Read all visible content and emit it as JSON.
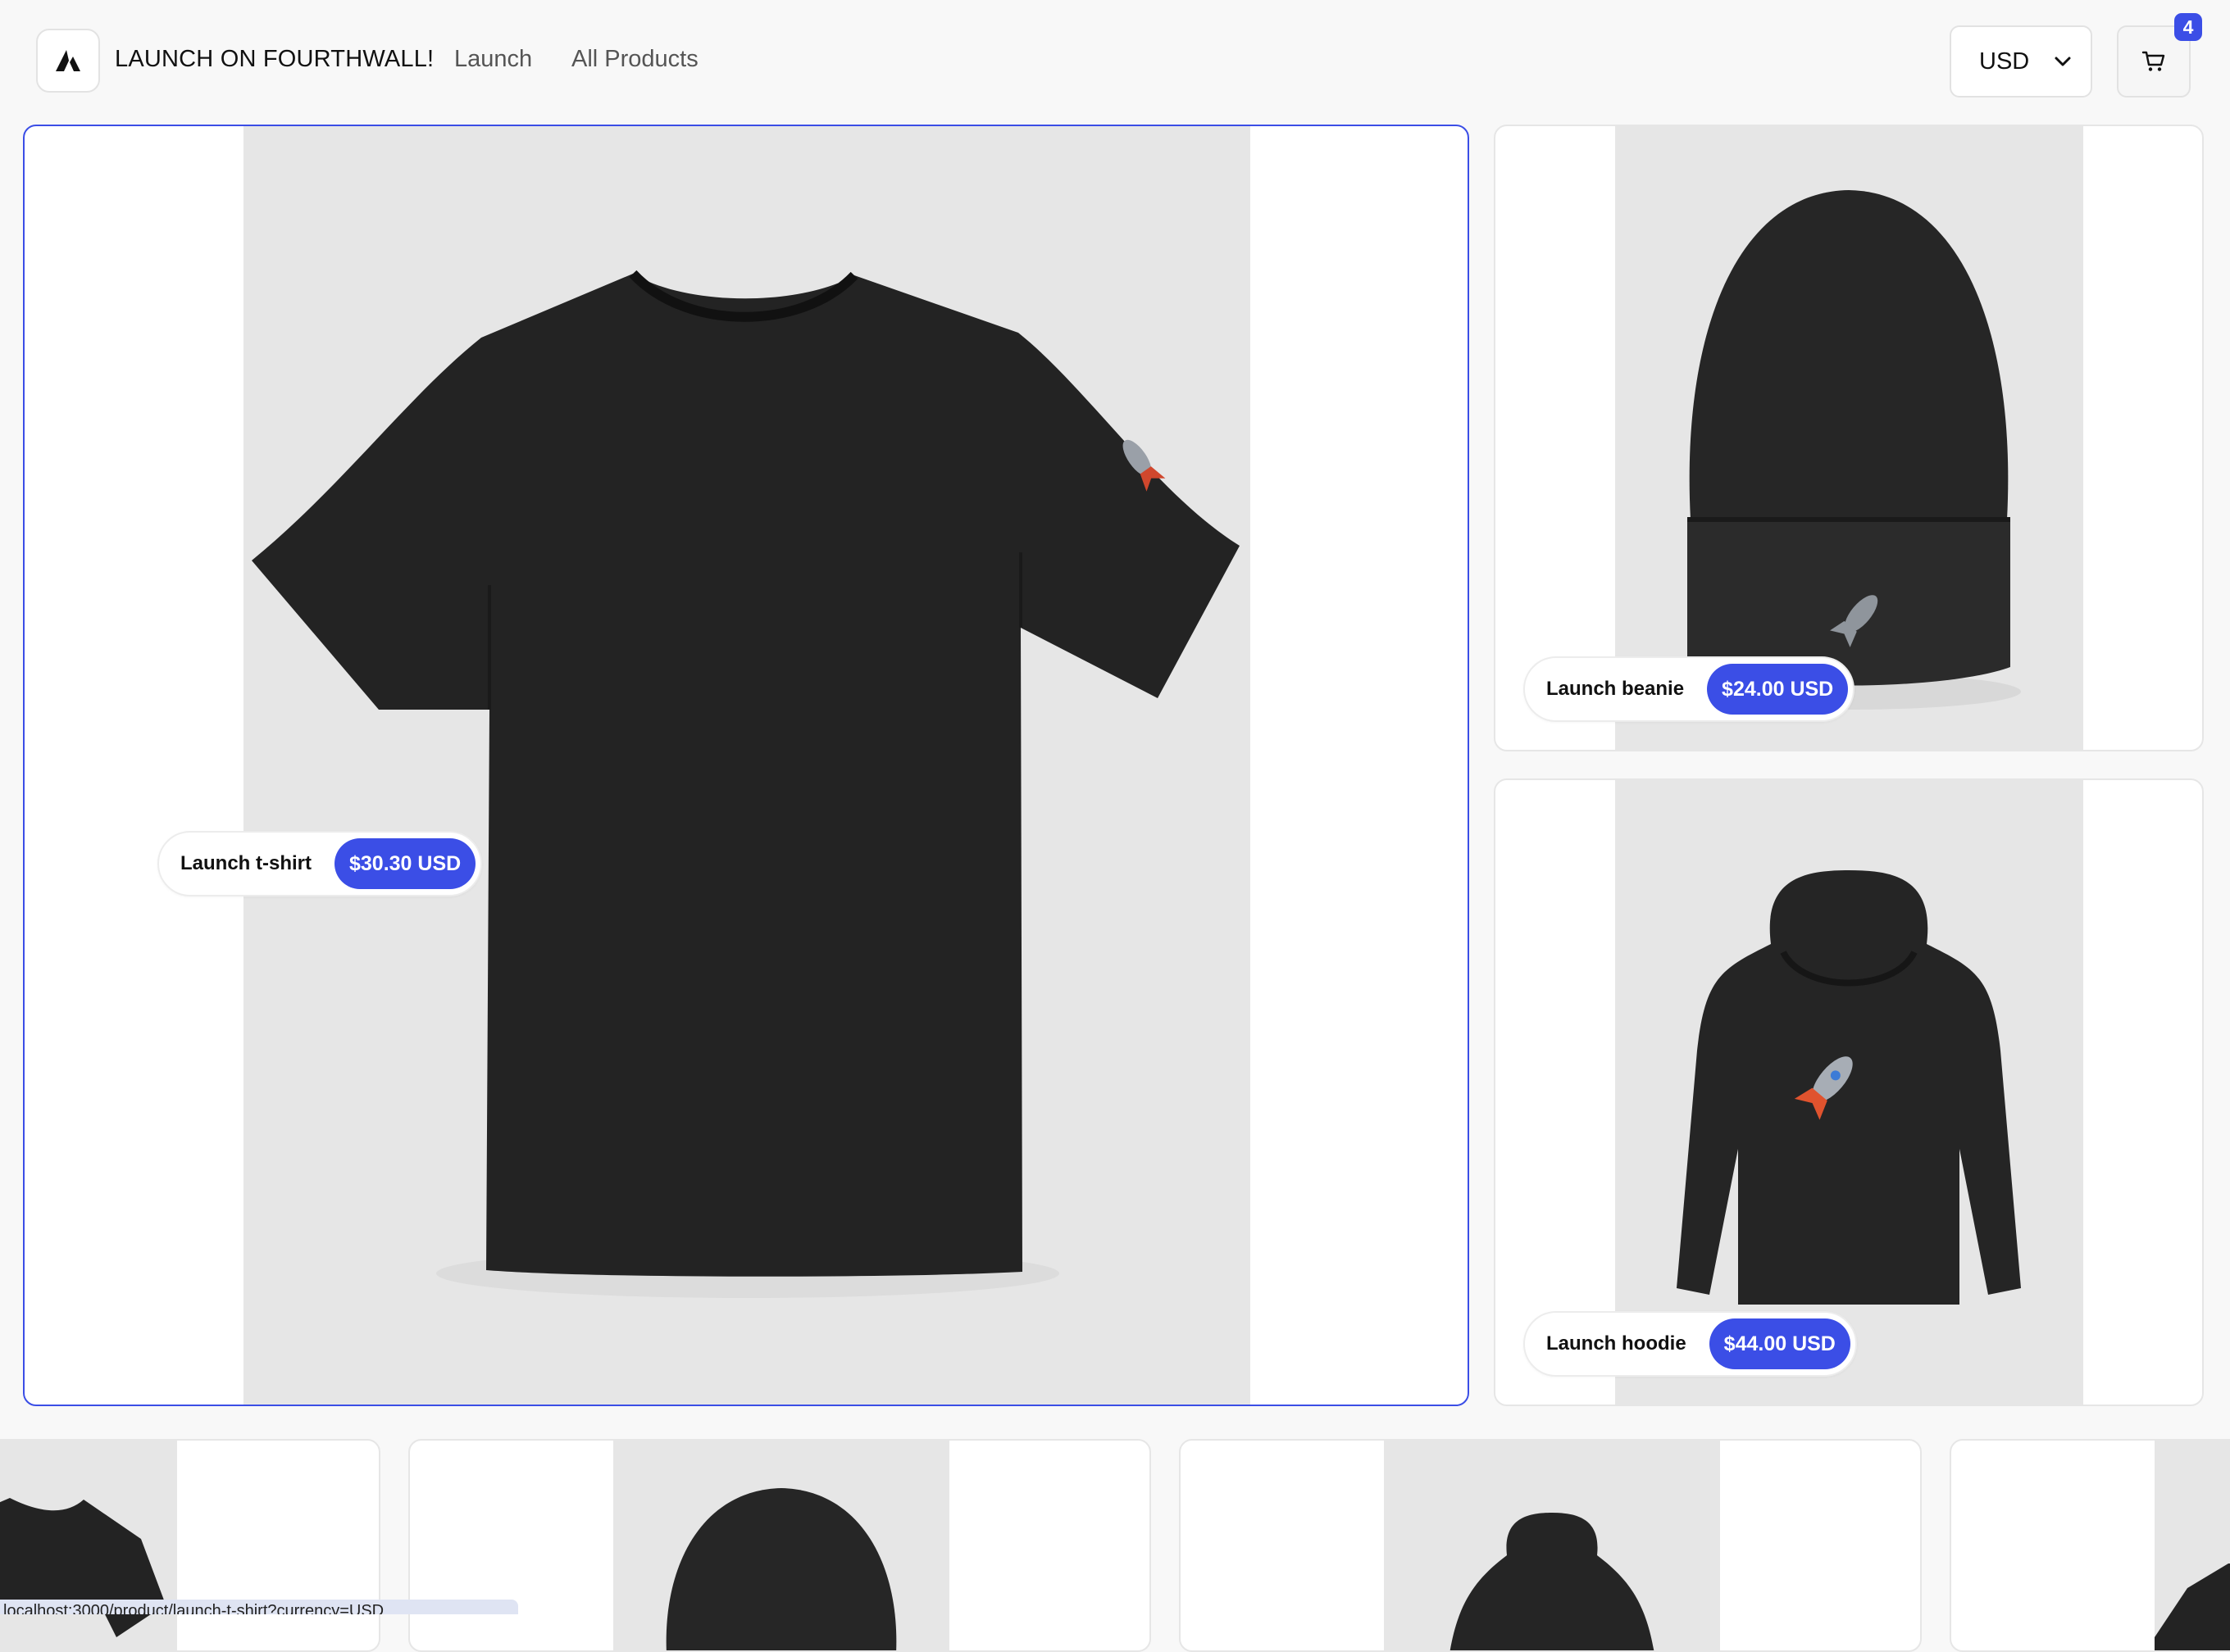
{
  "header": {
    "brand": "LAUNCH ON FOURTHWALL!",
    "nav": [
      {
        "label": "Launch"
      },
      {
        "label": "All Products"
      }
    ],
    "currency": "USD",
    "cart_count": "4"
  },
  "featured": [
    {
      "name": "Launch t-shirt",
      "price": "$30.30 USD"
    },
    {
      "name": "Launch beanie",
      "price": "$24.00 USD"
    },
    {
      "name": "Launch hoodie",
      "price": "$44.00 USD"
    }
  ],
  "status_bar": {
    "url": "localhost:3000/product/launch-t-shirt?currency=USD"
  },
  "colors": {
    "accent": "#3b4ee6",
    "photo_bg": "#e6e6e6",
    "garment": "#1f1f1f"
  }
}
